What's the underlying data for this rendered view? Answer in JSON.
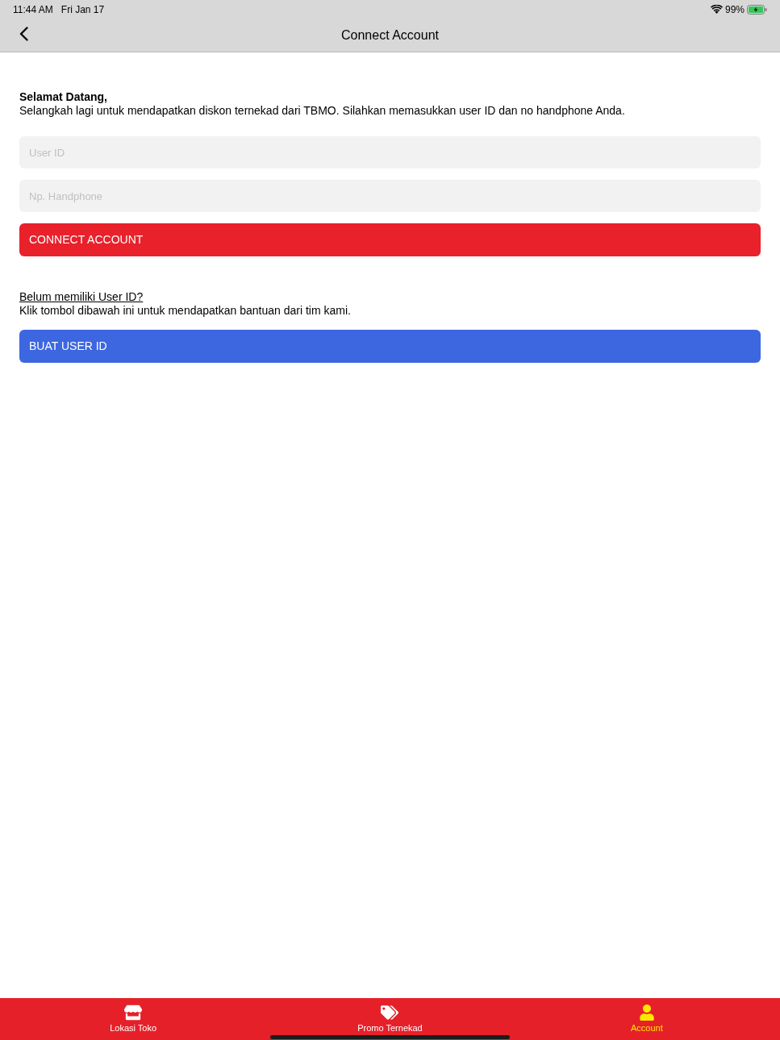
{
  "status_bar": {
    "time": "11:44 AM",
    "date": "Fri Jan 17",
    "battery": "99%",
    "charging": true
  },
  "nav_bar": {
    "title": "Connect Account"
  },
  "welcome": {
    "heading": "Selamat Datang,",
    "text": "Selangkah lagi untuk mendapatkan diskon ternekad dari TBMO. Silahkan memasukkan user ID dan no handphone Anda."
  },
  "fields": [
    {
      "placeholder": "User ID"
    },
    {
      "placeholder": "Np. Handphone"
    }
  ],
  "connect_button": {
    "label": "CONNECT ACCOUNT"
  },
  "signup": {
    "link": "Belum memiliki User ID?",
    "text": "Klik tombol dibawah ini untuk mendapatkan bantuan dari tim kami.",
    "button": "BUAT USER ID"
  },
  "tab_bar": {
    "tabs": [
      {
        "label": "Lokasi Toko",
        "kind": "store",
        "selected": false
      },
      {
        "label": "Promo Ternekad",
        "kind": "tags",
        "selected": false
      },
      {
        "label": "Account",
        "kind": "person",
        "selected": true
      }
    ]
  }
}
